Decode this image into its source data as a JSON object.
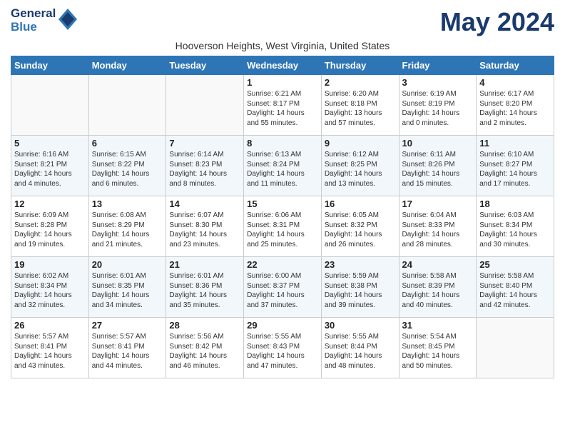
{
  "header": {
    "logo_line1": "General",
    "logo_line2": "Blue",
    "month_title": "May 2024",
    "location": "Hooverson Heights, West Virginia, United States"
  },
  "weekdays": [
    "Sunday",
    "Monday",
    "Tuesday",
    "Wednesday",
    "Thursday",
    "Friday",
    "Saturday"
  ],
  "weeks": [
    [
      {
        "day": "",
        "info": ""
      },
      {
        "day": "",
        "info": ""
      },
      {
        "day": "",
        "info": ""
      },
      {
        "day": "1",
        "info": "Sunrise: 6:21 AM\nSunset: 8:17 PM\nDaylight: 14 hours and 55 minutes."
      },
      {
        "day": "2",
        "info": "Sunrise: 6:20 AM\nSunset: 8:18 PM\nDaylight: 13 hours and 57 minutes."
      },
      {
        "day": "3",
        "info": "Sunrise: 6:19 AM\nSunset: 8:19 PM\nDaylight: 14 hours and 0 minutes."
      },
      {
        "day": "4",
        "info": "Sunrise: 6:17 AM\nSunset: 8:20 PM\nDaylight: 14 hours and 2 minutes."
      }
    ],
    [
      {
        "day": "5",
        "info": "Sunrise: 6:16 AM\nSunset: 8:21 PM\nDaylight: 14 hours and 4 minutes."
      },
      {
        "day": "6",
        "info": "Sunrise: 6:15 AM\nSunset: 8:22 PM\nDaylight: 14 hours and 6 minutes."
      },
      {
        "day": "7",
        "info": "Sunrise: 6:14 AM\nSunset: 8:23 PM\nDaylight: 14 hours and 8 minutes."
      },
      {
        "day": "8",
        "info": "Sunrise: 6:13 AM\nSunset: 8:24 PM\nDaylight: 14 hours and 11 minutes."
      },
      {
        "day": "9",
        "info": "Sunrise: 6:12 AM\nSunset: 8:25 PM\nDaylight: 14 hours and 13 minutes."
      },
      {
        "day": "10",
        "info": "Sunrise: 6:11 AM\nSunset: 8:26 PM\nDaylight: 14 hours and 15 minutes."
      },
      {
        "day": "11",
        "info": "Sunrise: 6:10 AM\nSunset: 8:27 PM\nDaylight: 14 hours and 17 minutes."
      }
    ],
    [
      {
        "day": "12",
        "info": "Sunrise: 6:09 AM\nSunset: 8:28 PM\nDaylight: 14 hours and 19 minutes."
      },
      {
        "day": "13",
        "info": "Sunrise: 6:08 AM\nSunset: 8:29 PM\nDaylight: 14 hours and 21 minutes."
      },
      {
        "day": "14",
        "info": "Sunrise: 6:07 AM\nSunset: 8:30 PM\nDaylight: 14 hours and 23 minutes."
      },
      {
        "day": "15",
        "info": "Sunrise: 6:06 AM\nSunset: 8:31 PM\nDaylight: 14 hours and 25 minutes."
      },
      {
        "day": "16",
        "info": "Sunrise: 6:05 AM\nSunset: 8:32 PM\nDaylight: 14 hours and 26 minutes."
      },
      {
        "day": "17",
        "info": "Sunrise: 6:04 AM\nSunset: 8:33 PM\nDaylight: 14 hours and 28 minutes."
      },
      {
        "day": "18",
        "info": "Sunrise: 6:03 AM\nSunset: 8:34 PM\nDaylight: 14 hours and 30 minutes."
      }
    ],
    [
      {
        "day": "19",
        "info": "Sunrise: 6:02 AM\nSunset: 8:34 PM\nDaylight: 14 hours and 32 minutes."
      },
      {
        "day": "20",
        "info": "Sunrise: 6:01 AM\nSunset: 8:35 PM\nDaylight: 14 hours and 34 minutes."
      },
      {
        "day": "21",
        "info": "Sunrise: 6:01 AM\nSunset: 8:36 PM\nDaylight: 14 hours and 35 minutes."
      },
      {
        "day": "22",
        "info": "Sunrise: 6:00 AM\nSunset: 8:37 PM\nDaylight: 14 hours and 37 minutes."
      },
      {
        "day": "23",
        "info": "Sunrise: 5:59 AM\nSunset: 8:38 PM\nDaylight: 14 hours and 39 minutes."
      },
      {
        "day": "24",
        "info": "Sunrise: 5:58 AM\nSunset: 8:39 PM\nDaylight: 14 hours and 40 minutes."
      },
      {
        "day": "25",
        "info": "Sunrise: 5:58 AM\nSunset: 8:40 PM\nDaylight: 14 hours and 42 minutes."
      }
    ],
    [
      {
        "day": "26",
        "info": "Sunrise: 5:57 AM\nSunset: 8:41 PM\nDaylight: 14 hours and 43 minutes."
      },
      {
        "day": "27",
        "info": "Sunrise: 5:57 AM\nSunset: 8:41 PM\nDaylight: 14 hours and 44 minutes."
      },
      {
        "day": "28",
        "info": "Sunrise: 5:56 AM\nSunset: 8:42 PM\nDaylight: 14 hours and 46 minutes."
      },
      {
        "day": "29",
        "info": "Sunrise: 5:55 AM\nSunset: 8:43 PM\nDaylight: 14 hours and 47 minutes."
      },
      {
        "day": "30",
        "info": "Sunrise: 5:55 AM\nSunset: 8:44 PM\nDaylight: 14 hours and 48 minutes."
      },
      {
        "day": "31",
        "info": "Sunrise: 5:54 AM\nSunset: 8:45 PM\nDaylight: 14 hours and 50 minutes."
      },
      {
        "day": "",
        "info": ""
      }
    ]
  ]
}
